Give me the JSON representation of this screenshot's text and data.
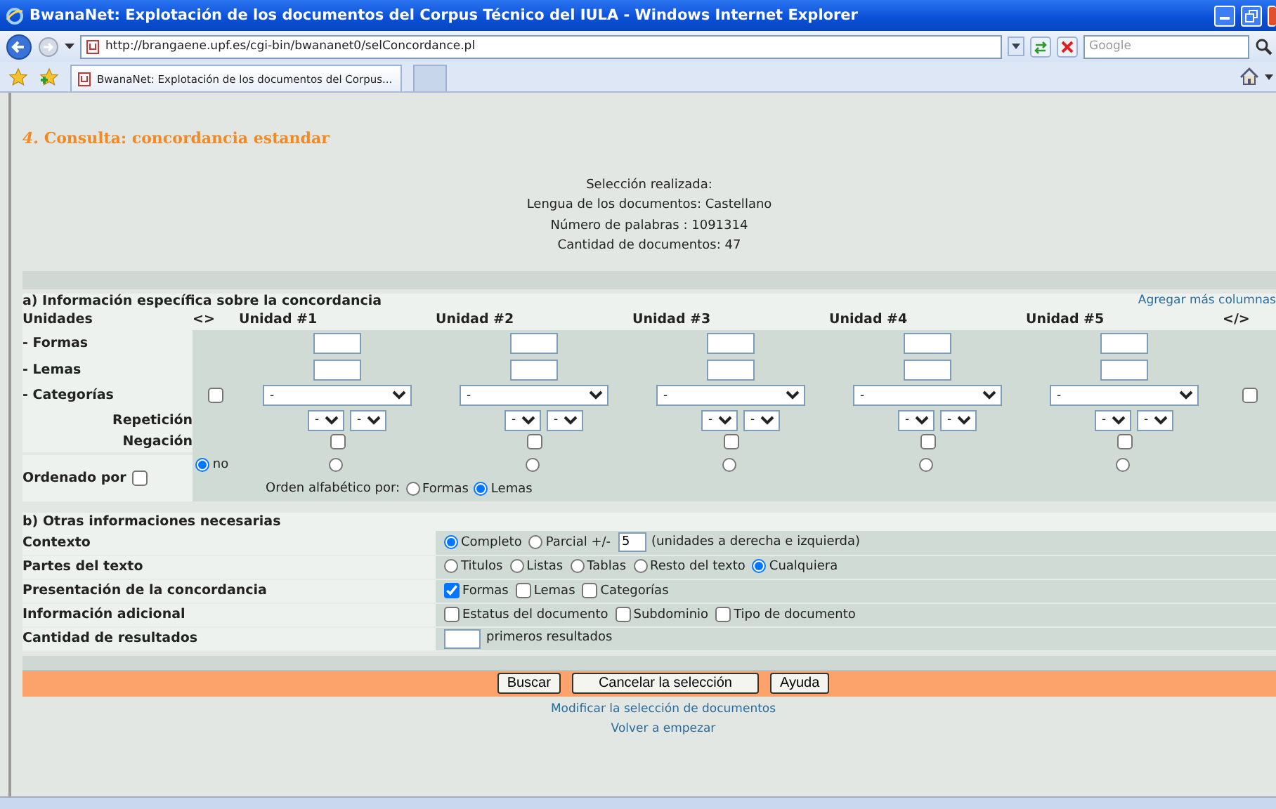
{
  "window": {
    "title": "BwanaNet: Explotación de los documentos del Corpus Técnico del IULA - Windows Internet Explorer"
  },
  "address_bar": {
    "url": "http://brangaene.upf.es/cgi-bin/bwananet0/selConcordance.pl",
    "search_placeholder": "Google"
  },
  "tabs": [
    {
      "label": "BwanaNet: Explotación de los documentos del Corpus...",
      "selected": true
    }
  ],
  "heading": "*4.* Consulta: concordancia estandar",
  "selection": [
    "Selección realizada:",
    "Lengua de los documentos: Castellano",
    "Número de palabras : 1091314",
    "Cantidad de documentos: 47"
  ],
  "section_a": {
    "title": "a) Información específica sobre la concordancia",
    "more_link": "Agregar más columnas",
    "header": {
      "units_label": "Unidades",
      "open_mark": "<>",
      "close_mark": "</>"
    },
    "row_labels": {
      "forms": "- Formas",
      "lemmas": "- Lemas",
      "categories": "- Categorías",
      "repetition": "Repetición",
      "negation": "Negación",
      "order": "Ordenado por"
    },
    "categories_left_checked": false,
    "categories_right_checked": false,
    "order_checked": false,
    "order_none": {
      "label": "no",
      "selected": true
    },
    "units": [
      {
        "label": "Unidad #1",
        "category": "-",
        "repetition": [
          "-",
          "-"
        ],
        "negation": false,
        "order_selected": false
      },
      {
        "label": "Unidad #2",
        "category": "-",
        "repetition": [
          "-",
          "-"
        ],
        "negation": false,
        "order_selected": false
      },
      {
        "label": "Unidad #3",
        "category": "-",
        "repetition": [
          "-",
          "-"
        ],
        "negation": false,
        "order_selected": false
      },
      {
        "label": "Unidad #4",
        "category": "-",
        "repetition": [
          "-",
          "-"
        ],
        "negation": false,
        "order_selected": false
      },
      {
        "label": "Unidad #5",
        "category": "-",
        "repetition": [
          "-",
          "-"
        ],
        "negation": false,
        "order_selected": false
      }
    ],
    "alphabetical": {
      "label": "Orden alfabético por:",
      "options": [
        {
          "label": "Formas",
          "selected": false
        },
        {
          "label": "Lemas",
          "selected": true
        }
      ]
    }
  },
  "section_b": {
    "title": "b) Otras informaciones necesarias",
    "rows": [
      {
        "label": "Contexto",
        "items": [
          {
            "kind": "radio",
            "label": "Completo",
            "selected": true
          },
          {
            "kind": "radio",
            "label": "Parcial +/-",
            "selected": false
          },
          {
            "kind": "input",
            "value": "5"
          },
          {
            "kind": "text",
            "text": "(unidades a derecha e izquierda)"
          }
        ]
      },
      {
        "label": "Partes del texto",
        "items": [
          {
            "kind": "radio",
            "label": "Titulos",
            "selected": false
          },
          {
            "kind": "radio",
            "label": "Listas",
            "selected": false
          },
          {
            "kind": "radio",
            "label": "Tablas",
            "selected": false
          },
          {
            "kind": "radio",
            "label": "Resto del texto",
            "selected": false
          },
          {
            "kind": "radio",
            "label": "Cualquiera",
            "selected": true
          }
        ]
      },
      {
        "label": "Presentación de la concordancia",
        "items": [
          {
            "kind": "checkbox",
            "label": "Formas",
            "checked": true
          },
          {
            "kind": "checkbox",
            "label": "Lemas",
            "checked": false
          },
          {
            "kind": "checkbox",
            "label": "Categorías",
            "checked": false
          }
        ]
      },
      {
        "label": "Información adicional",
        "items": [
          {
            "kind": "checkbox",
            "label": "Estatus del documento",
            "checked": false
          },
          {
            "kind": "checkbox",
            "label": "Subdominio",
            "checked": false
          },
          {
            "kind": "checkbox",
            "label": "Tipo de documento",
            "checked": false
          }
        ]
      },
      {
        "label": "Cantidad de resultados",
        "items": [
          {
            "kind": "input"
          },
          {
            "kind": "text",
            "text": "primeros resultados"
          }
        ]
      }
    ]
  },
  "buttons": [
    "Buscar",
    "Cancelar la selección",
    "Ayuda"
  ],
  "links": [
    "Modificar la selección de documentos",
    "Volver a empezar"
  ]
}
